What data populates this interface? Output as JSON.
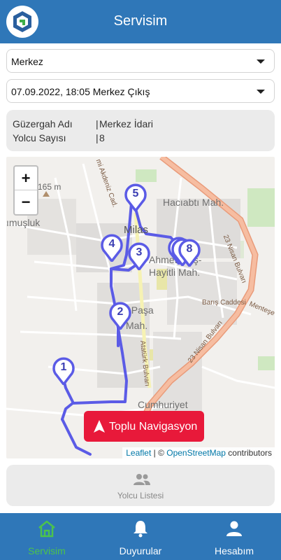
{
  "header": {
    "title": "Servisim"
  },
  "filters": {
    "location": "Merkez",
    "trip": "07.09.2022, 18:05 Merkez Çıkış"
  },
  "info": {
    "route_label": "Güzergah Adı",
    "route_value": "Merkez İdari",
    "passenger_label": "Yolcu Sayısı",
    "passenger_value": "8",
    "separator": "|"
  },
  "map": {
    "zoom_in": "+",
    "zoom_out": "−",
    "labels": {
      "elevation": "165 m",
      "district_1": "Hacıabtı Mah.",
      "town": "Milas",
      "district_2": "Ahmet Muş-",
      "district_3": "Hayitli Mah.",
      "district_4": "t Paşa",
      "district_5": "Mah.",
      "district_6": "Cumhuriyet",
      "district_7": "ımuşluk",
      "road_1": "23 Nisan Bulvarı",
      "road_2": "23 Nisan Bulvarı",
      "road_3": "Atatürk Bulvarı",
      "road_4": "Barış Caddesi",
      "road_5": "Menteşe",
      "road_6": "mi Akdeniz Cad."
    },
    "markers": [
      "1",
      "2",
      "3",
      "4",
      "5",
      "",
      "",
      "8"
    ],
    "navigate_button": "Toplu Navigasyon",
    "attribution": {
      "leaflet": "Leaflet",
      "sep": " | © ",
      "osm": "OpenStreetMap",
      "tail": " contributors"
    },
    "colors": {
      "route": "#5b5be6",
      "marker": "#5b5be6",
      "main_road": "#f0a782"
    }
  },
  "passenger_list": {
    "label": "Yolcu Listesi",
    "icon": "people-icon"
  },
  "tabs": [
    {
      "label": "Servisim",
      "icon": "home-icon",
      "active": true
    },
    {
      "label": "Duyurular",
      "icon": "bell-icon",
      "active": false
    },
    {
      "label": "Hesabım",
      "icon": "person-icon",
      "active": false
    }
  ],
  "colors": {
    "primary": "#2f77b8",
    "active_tab": "#4cc34c",
    "cta": "#e8193a"
  }
}
